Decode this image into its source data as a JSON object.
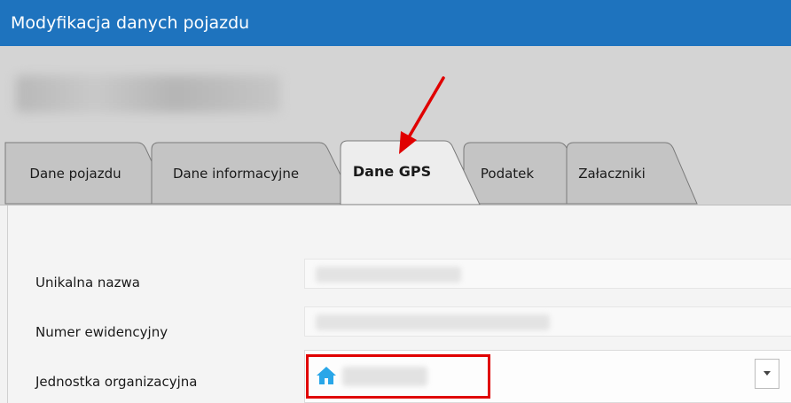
{
  "window": {
    "title": "Modyfikacja danych pojazdu"
  },
  "tabs": [
    {
      "label": "Dane pojazdu",
      "active": false
    },
    {
      "label": "Dane informacyjne",
      "active": false
    },
    {
      "label": "Dane GPS",
      "active": true
    },
    {
      "label": "Podatek",
      "active": false
    },
    {
      "label": "Załaczniki",
      "active": false
    }
  ],
  "form": {
    "unique_name_label": "Unikalna nazwa",
    "registry_number_label": "Numer ewidencyjny",
    "org_unit_label": "Jednostka organizacyjna"
  },
  "icons": {
    "org_unit": "home-icon",
    "dropdown": "chevron-down-icon"
  },
  "colors": {
    "titlebar": "#1e73be",
    "annotation": "#e00000",
    "home_icon": "#29a6e8"
  }
}
